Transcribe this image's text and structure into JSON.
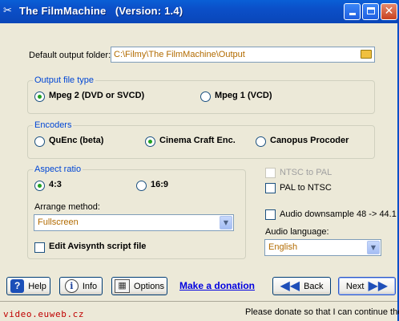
{
  "window": {
    "title": "The FilmMachine   (Version: 1.4)",
    "icon": "film-icon"
  },
  "output_folder": {
    "label": "Default output folder:",
    "value": "C:\\Filmy\\The FilmMachine\\Output"
  },
  "output_type": {
    "title": "Output file type",
    "options": [
      "Mpeg 2 (DVD or SVCD)",
      "Mpeg 1 (VCD)"
    ],
    "selected": 0
  },
  "encoders": {
    "title": "Encoders",
    "options": [
      "QuEnc (beta)",
      "Cinema Craft Enc.",
      "Canopus Procoder"
    ],
    "selected": 1
  },
  "aspect": {
    "title": "Aspect ratio",
    "options": [
      "4:3",
      "16:9"
    ],
    "selected": 0,
    "arrange_label": "Arrange method:",
    "arrange_value": "Fullscreen",
    "avisynth_label": "Edit Avisynth script file"
  },
  "conversion": {
    "ntsc_to_pal": "NTSC to PAL",
    "pal_to_ntsc": "PAL to NTSC",
    "downsample": "Audio downsample 48 -> 44.1",
    "audio_language_label": "Audio language:",
    "audio_language_value": "English"
  },
  "buttons": {
    "help": "Help",
    "info": "Info",
    "options": "Options",
    "donation": "Make a donation",
    "back": "Back",
    "next": "Next"
  },
  "footer": {
    "url": "video.euweb.cz",
    "message": "Please donate so that I can continue the"
  },
  "colors": {
    "accent": "#0046d5",
    "field_text": "#b26b00",
    "url": "#c00000"
  }
}
